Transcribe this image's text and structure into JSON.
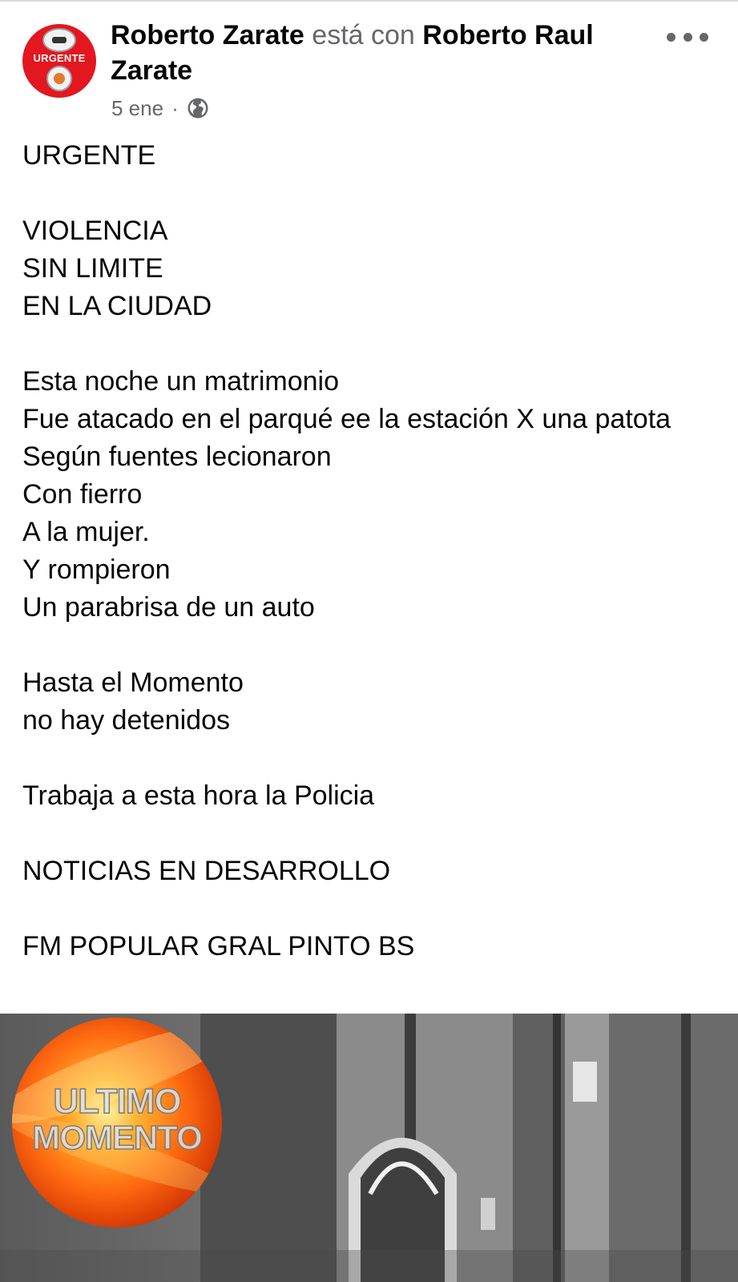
{
  "post": {
    "author": "Roberto Zarate",
    "with_word": "está con",
    "tagged": "Roberto Raul Zarate",
    "date": "5 ene",
    "separator": "·",
    "privacy_icon": "globe-icon",
    "avatar_label": "URGENTE",
    "more_icon": "more-options-icon",
    "body": "URGENTE\n\nVIOLENCIA\nSIN LIMITE\nEN LA CIUDAD\n\nEsta noche un matrimonio\nFue atacado en el parqué ee la estación X una patota\nSegún fuentes lecionaron\nCon fierro\nA la mujer.\nY rompieron\nUn parabrisa de un auto\n\nHasta el Momento\nno hay detenidos\n\nTrabaja a esta hora la Policia\n\nNOTICIAS EN DESARROLLO\n\nFM POPULAR GRAL PINTO BS"
  },
  "media": {
    "badge_line_1": "ULTIMO",
    "badge_line_2": "MOMENTO"
  },
  "colors": {
    "text": "#050505",
    "muted": "#65676b",
    "avatar_red": "#e3171f",
    "badge_orange": "#ff6a10"
  }
}
